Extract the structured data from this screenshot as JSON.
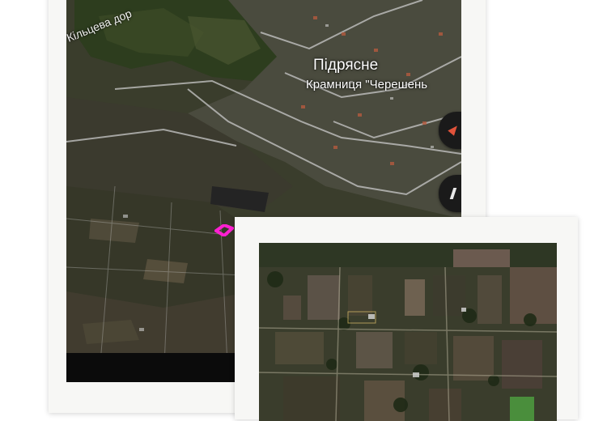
{
  "map_main": {
    "place_label": "Підрясне",
    "shop_label": "Крамниця \"Черешень",
    "road_label": "Кільцева дор",
    "plot_marker_color": "#ff1fd2",
    "icons": [
      "navigate-icon",
      "layers-icon"
    ]
  },
  "colors": {
    "frame": "#f7f7f5",
    "forest": "#2b3a1c",
    "field_dark": "#39362a",
    "road": "#c9c9c9"
  }
}
